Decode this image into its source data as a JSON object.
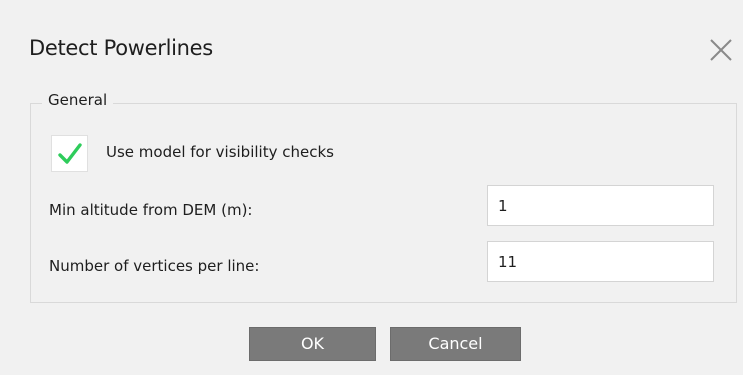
{
  "dialog": {
    "title": "Detect Powerlines",
    "close_icon": "close-icon"
  },
  "general": {
    "legend": "General",
    "visibility_check": {
      "label": "Use model for visibility checks",
      "checked": true,
      "check_color": "#2ecc5b"
    },
    "min_altitude": {
      "label": "Min altitude from DEM (m):",
      "value": "1"
    },
    "vertices": {
      "label": "Number of vertices per line:",
      "value": "11"
    }
  },
  "buttons": {
    "ok_label": "OK",
    "cancel_label": "Cancel"
  }
}
